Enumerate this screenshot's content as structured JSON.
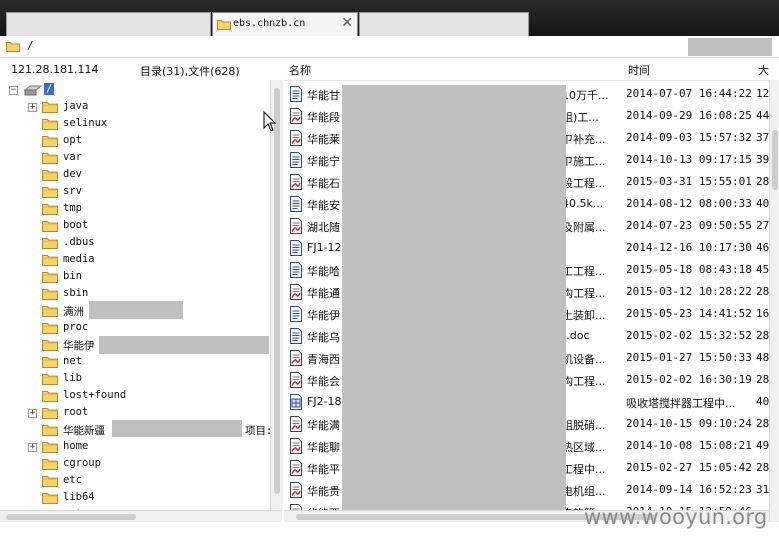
{
  "tabs": [
    {
      "title": ""
    },
    {
      "title": "ebs.chnzb.cn",
      "close_glyph": "✕"
    },
    {
      "title": ""
    }
  ],
  "path": "/",
  "info": {
    "ip": "121.28.181.114",
    "counts": "目录(31),文件(628)"
  },
  "columns": {
    "name": "名称",
    "time": "时间",
    "size": "大"
  },
  "tree": {
    "root_label": "/",
    "items": [
      {
        "label": "java",
        "expandable": true
      },
      {
        "label": "selinux",
        "expandable": false
      },
      {
        "label": "opt",
        "expandable": false
      },
      {
        "label": "var",
        "expandable": false
      },
      {
        "label": "dev",
        "expandable": false
      },
      {
        "label": "srv",
        "expandable": false
      },
      {
        "label": "tmp",
        "expandable": false
      },
      {
        "label": "boot",
        "expandable": false
      },
      {
        "label": ".dbus",
        "expandable": false
      },
      {
        "label": "media",
        "expandable": false
      },
      {
        "label": "bin",
        "expandable": false
      },
      {
        "label": "sbin",
        "expandable": false
      },
      {
        "label": "满洲",
        "expandable": false
      },
      {
        "label": "proc",
        "expandable": false
      },
      {
        "label": "华能伊",
        "expandable": false
      },
      {
        "label": "net",
        "expandable": false
      },
      {
        "label": "lib",
        "expandable": false
      },
      {
        "label": "lost+found",
        "expandable": false
      },
      {
        "label": "root",
        "expandable": true
      },
      {
        "label": "华能新疆",
        "suffix": "项目:",
        "expandable": false
      },
      {
        "label": "home",
        "expandable": true
      },
      {
        "label": "cgroup",
        "expandable": false
      },
      {
        "label": "etc",
        "expandable": false
      },
      {
        "label": "lib64",
        "expandable": false
      },
      {
        "label": "mnt",
        "expandable": false
      }
    ]
  },
  "files": [
    {
      "name": "华能甘",
      "tail": "10万千...",
      "time": "2014-07-07 16:44:22",
      "size": "12",
      "icon": "doc"
    },
    {
      "name": "华能段",
      "tail": "组)工...",
      "time": "2014-09-29 16:08:25",
      "size": "44",
      "icon": "pdf"
    },
    {
      "name": "华能莱",
      "tail": "ㄗ补充...",
      "time": "2014-09-03 15:57:32",
      "size": "37",
      "icon": "pdf"
    },
    {
      "name": "华能宁",
      "tail": "ㄗ施工...",
      "time": "2014-10-13 09:17:15",
      "size": "39",
      "icon": "doc"
    },
    {
      "name": "华能石",
      "tail": "段工程...",
      "time": "2015-03-31 15:55:01",
      "size": "28",
      "icon": "pdf"
    },
    {
      "name": "华能安",
      "tail": " 40.5k...",
      "time": "2014-08-12 08:00:33",
      "size": "40",
      "icon": "doc"
    },
    {
      "name": "湖北随",
      "tail": "及附属...",
      "time": "2014-07-23 09:50:55",
      "size": "27",
      "icon": "pdf"
    },
    {
      "name": "FJ1-12",
      "tail": "",
      "time": "2014-12-16 10:17:30",
      "size": "46",
      "icon": "doc"
    },
    {
      "name": "华能哈",
      "tail": "工工程...",
      "time": "2015-05-18 08:43:18",
      "size": "45",
      "icon": "doc"
    },
    {
      "name": "华能通",
      "tail": "构工程...",
      "time": "2015-03-12 10:28:22",
      "size": "28",
      "icon": "pdf"
    },
    {
      "name": "华能伊",
      "tail": "土装卸...",
      "time": "2015-05-23 14:41:52",
      "size": "16",
      "icon": "doc"
    },
    {
      "name": "华能乌",
      "tail": ").doc",
      "time": "2015-02-02 15:32:52",
      "size": "28",
      "icon": "doc"
    },
    {
      "name": "青海西",
      "tail": "机设备...",
      "time": "2015-01-27 15:50:33",
      "size": "48",
      "icon": "pdf"
    },
    {
      "name": "华能会",
      "tail": "构工程...",
      "time": "2015-02-02 16:30:19",
      "size": "28",
      "icon": "pdf"
    },
    {
      "name": "FJ2-18",
      "tail": "吸收塔搅拌器工程中...",
      "time": "",
      "size": "40",
      "icon": "xls"
    },
    {
      "name": "华能满",
      "tail": "组脱硝...",
      "time": "2014-10-15 09:10:24",
      "size": "28",
      "icon": "pdf"
    },
    {
      "name": "华能聊",
      "tail": "热区域...",
      "time": "2014-10-08 15:08:21",
      "size": "49",
      "icon": "pdf"
    },
    {
      "name": "华能平",
      "tail": "工程中...",
      "time": "2015-02-27 15:05:42",
      "size": "28",
      "icon": "pdf"
    },
    {
      "name": "华能贵",
      "tail": "电机组...",
      "time": "2014-09-14 16:52:23",
      "size": "31",
      "icon": "pdf"
    },
    {
      "name": "华能西",
      "tail": "央软管...",
      "time": "2014-10-15 12:59:46",
      "size": "",
      "icon": "pdf"
    }
  ],
  "watermark": "www.wooyun.org"
}
